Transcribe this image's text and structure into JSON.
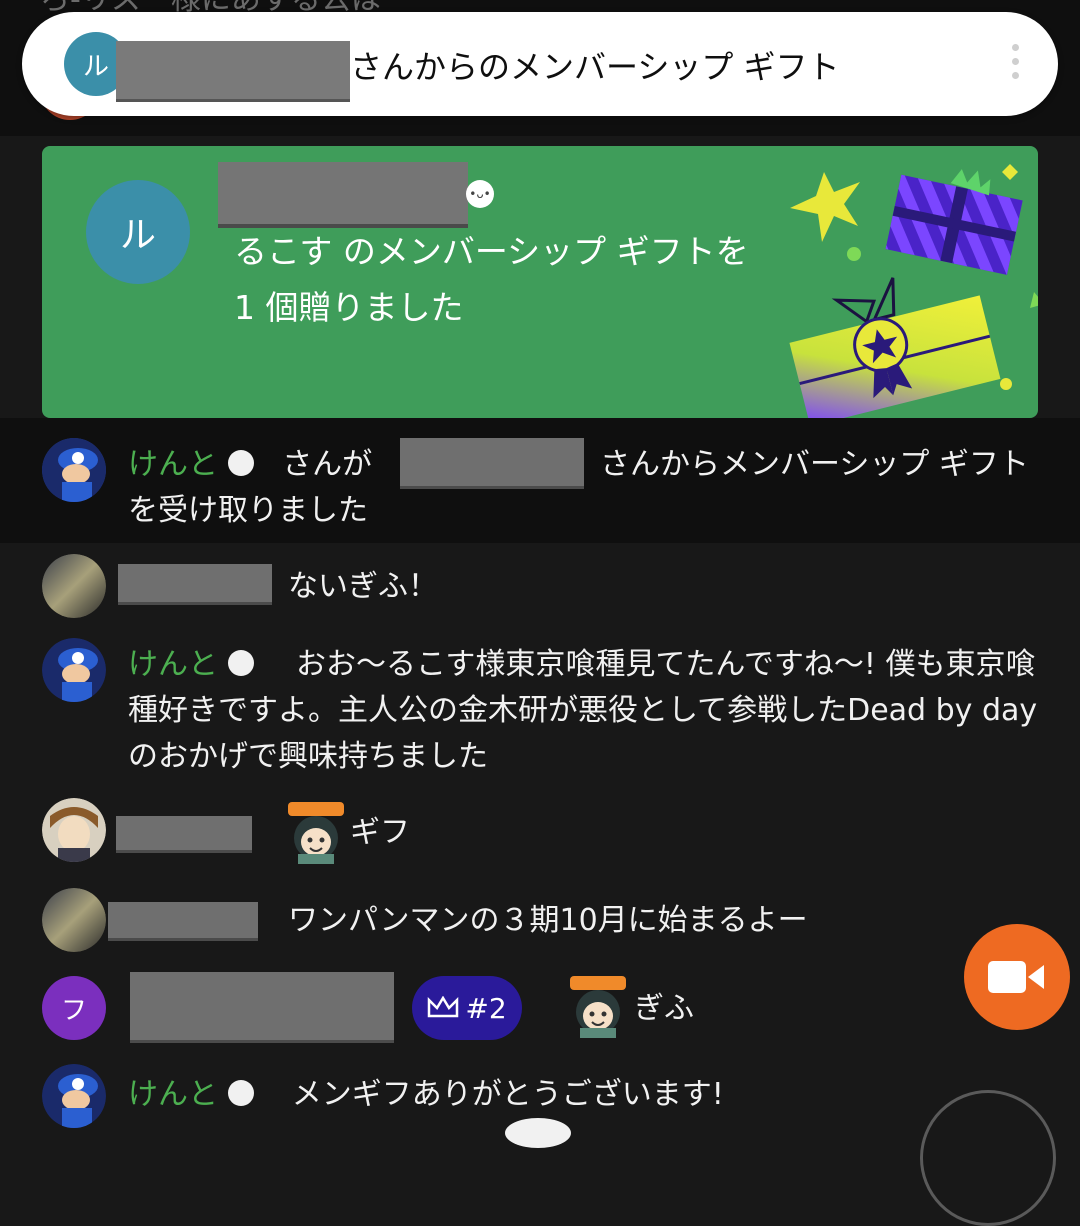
{
  "top": {
    "ghost_text": "ろ-リス　様にあする公は"
  },
  "notification": {
    "avatar_initial": "ル",
    "text": "さんからのメンバーシップ ギフト"
  },
  "gift_card": {
    "avatar_initial": "ル",
    "message": "るこす のメンバーシップ ギフトを 1 個贈りました",
    "art_icons": [
      "star-icon",
      "gift-box-icon",
      "ribbon-star-icon"
    ]
  },
  "messages": [
    {
      "author": "けんと",
      "text_before": "さんが",
      "text_after": "さんからメンバーシップ ギフトを受け取りました"
    },
    {
      "author": "",
      "text": "ないぎふ！"
    },
    {
      "author": "けんと",
      "text": "おお〜るこす様東京喰種見てたんですね〜! 僕も東京喰種好きですよ。主人公の金木研が悪役として参戦したDead by dayのおかげで興味持ちました"
    },
    {
      "author": "",
      "text": "ギフ"
    },
    {
      "author": "",
      "text": "ワンパンマンの３期10月に始まるよー"
    },
    {
      "author": "",
      "avatar_initial": "フ",
      "member_badge": "#2",
      "text": "ぎふ"
    },
    {
      "author": "けんと",
      "text": "メンギフありがとうございます!"
    }
  ],
  "colors": {
    "background": "#181818",
    "gift_green": "#3f9d5a",
    "accent_orange": "#ee6a22",
    "member_chip": "#2a1a9a",
    "author_green": "#4caf50"
  }
}
